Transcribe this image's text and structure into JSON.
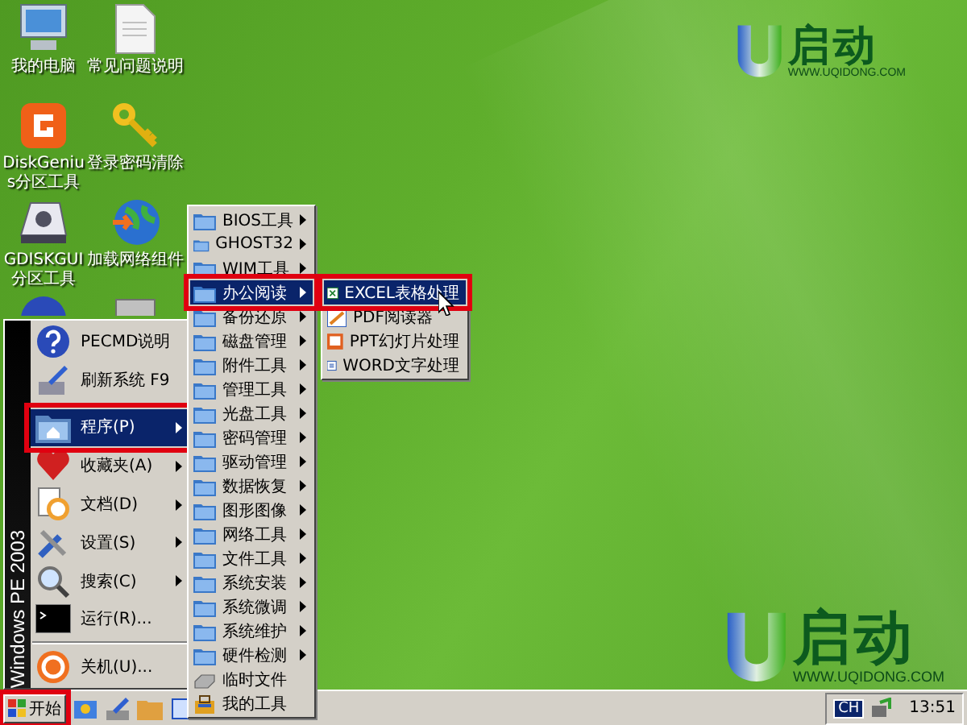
{
  "desktop_icons": [
    {
      "label": "我的电脑"
    },
    {
      "label": "常见问题说明"
    },
    {
      "label": "DiskGenius分区工具"
    },
    {
      "label": "登录密码清除"
    },
    {
      "label": "GDISKGUI分区工具"
    },
    {
      "label": "加载网络组件"
    }
  ],
  "logo": {
    "title": "启动",
    "url": "WWW.UQIDONG.COM"
  },
  "logo_bottom": {
    "title": "启动",
    "url": "WWW.UQIDONG.COM"
  },
  "start_menu": {
    "side_label": "Windows PE 2003",
    "groups": [
      [
        {
          "label": "PECMD说明",
          "has_submenu": false,
          "selected": false
        },
        {
          "label": "刷新系统 F9",
          "has_submenu": false,
          "selected": false
        }
      ],
      [
        {
          "label": "程序(P)",
          "has_submenu": true,
          "selected": true
        },
        {
          "label": "收藏夹(A)",
          "has_submenu": true,
          "selected": false
        },
        {
          "label": "文档(D)",
          "has_submenu": true,
          "selected": false
        },
        {
          "label": "设置(S)",
          "has_submenu": true,
          "selected": false
        },
        {
          "label": "搜索(C)",
          "has_submenu": true,
          "selected": false
        },
        {
          "label": "运行(R)...",
          "has_submenu": false,
          "selected": false
        }
      ],
      [
        {
          "label": "关机(U)...",
          "has_submenu": false,
          "selected": false
        }
      ]
    ]
  },
  "programs_menu": [
    {
      "label": "BIOS工具",
      "kind": "folder",
      "selected": false
    },
    {
      "label": "GHOST32",
      "kind": "folder",
      "selected": false
    },
    {
      "label": "WIM工具",
      "kind": "folder",
      "selected": false
    },
    {
      "label": "办公阅读",
      "kind": "folder",
      "selected": true
    },
    {
      "label": "备份还原",
      "kind": "folder",
      "selected": false
    },
    {
      "label": "磁盘管理",
      "kind": "folder",
      "selected": false
    },
    {
      "label": "附件工具",
      "kind": "folder",
      "selected": false
    },
    {
      "label": "管理工具",
      "kind": "folder",
      "selected": false
    },
    {
      "label": "光盘工具",
      "kind": "folder",
      "selected": false
    },
    {
      "label": "密码管理",
      "kind": "folder",
      "selected": false
    },
    {
      "label": "驱动管理",
      "kind": "folder",
      "selected": false
    },
    {
      "label": "数据恢复",
      "kind": "folder",
      "selected": false
    },
    {
      "label": "图形图像",
      "kind": "folder",
      "selected": false
    },
    {
      "label": "网络工具",
      "kind": "folder",
      "selected": false
    },
    {
      "label": "文件工具",
      "kind": "folder",
      "selected": false
    },
    {
      "label": "系统安装",
      "kind": "folder",
      "selected": false
    },
    {
      "label": "系统微调",
      "kind": "folder",
      "selected": false
    },
    {
      "label": "系统维护",
      "kind": "folder",
      "selected": false
    },
    {
      "label": "硬件检测",
      "kind": "folder",
      "selected": false
    },
    {
      "label": "临时文件",
      "kind": "drive",
      "selected": false
    },
    {
      "label": "我的工具",
      "kind": "toolbox",
      "selected": false
    }
  ],
  "office_menu": [
    {
      "label": "EXCEL表格处理",
      "selected": true
    },
    {
      "label": "PDF阅读器",
      "selected": false
    },
    {
      "label": "PPT幻灯片处理",
      "selected": false
    },
    {
      "label": "WORD文字处理",
      "selected": false
    }
  ],
  "taskbar": {
    "start_button": {
      "label": "开始",
      "highlighted": true
    },
    "language": "CH",
    "clock": "13:51"
  }
}
